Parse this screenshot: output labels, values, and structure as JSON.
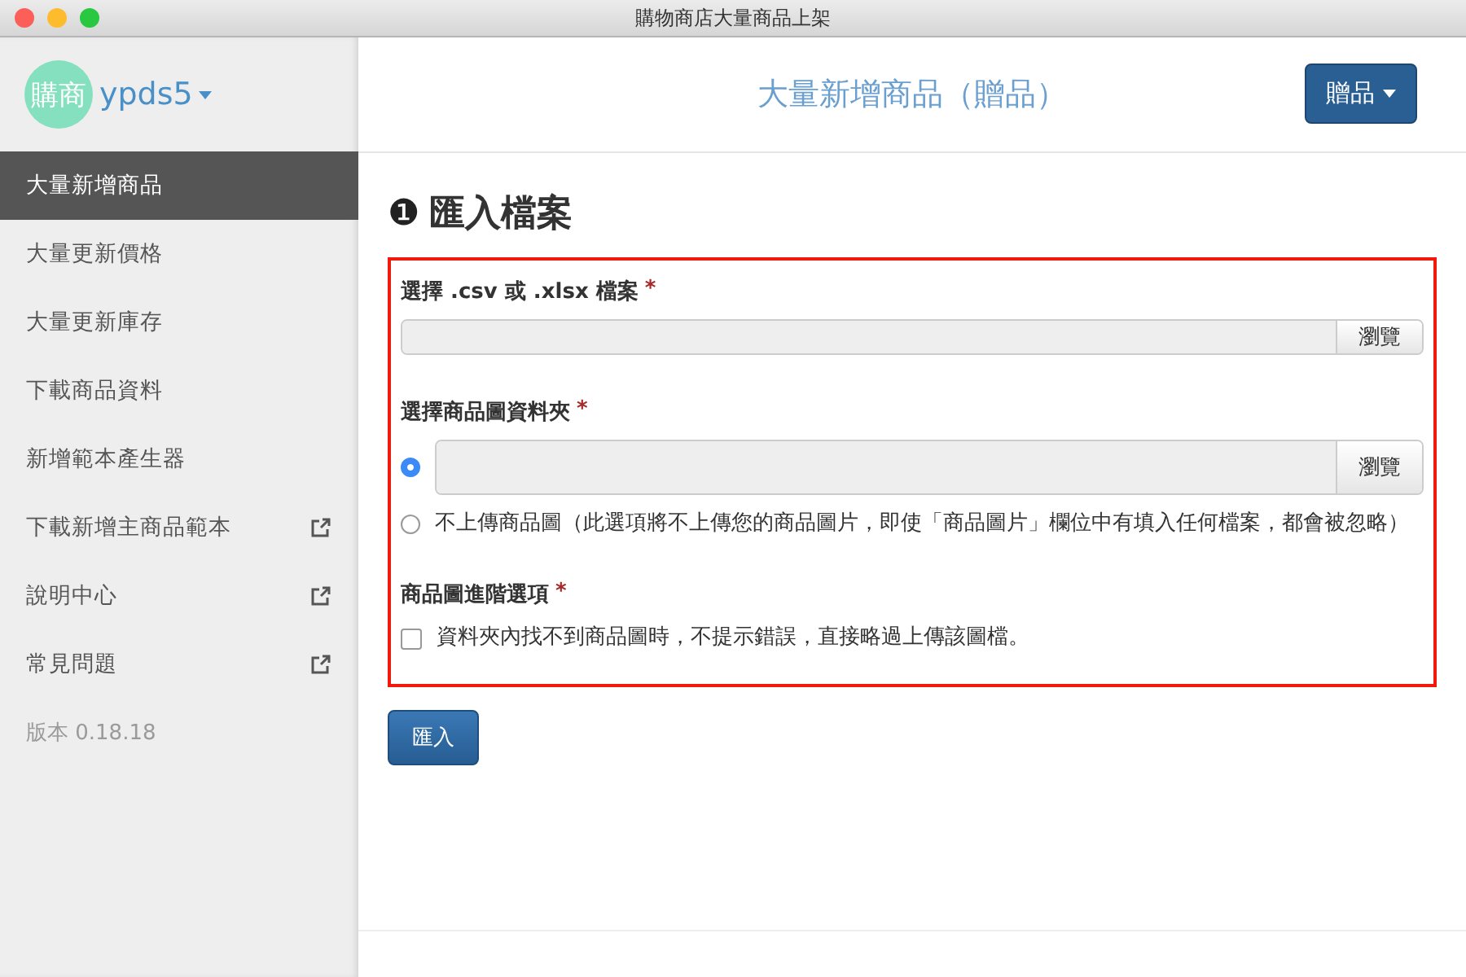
{
  "window": {
    "title": "購物商店大量商品上架"
  },
  "sidebar": {
    "avatar": "購商",
    "user": "ypds5",
    "items": [
      {
        "label": "大量新增商品",
        "selected": true,
        "external": false
      },
      {
        "label": "大量更新價格",
        "selected": false,
        "external": false
      },
      {
        "label": "大量更新庫存",
        "selected": false,
        "external": false
      },
      {
        "label": "下載商品資料",
        "selected": false,
        "external": false
      },
      {
        "label": "新增範本產生器",
        "selected": false,
        "external": false
      },
      {
        "label": "下載新增主商品範本",
        "selected": false,
        "external": true
      },
      {
        "label": "說明中心",
        "selected": false,
        "external": true
      },
      {
        "label": "常見問題",
        "selected": false,
        "external": true
      }
    ],
    "version": "版本 0.18.18"
  },
  "header": {
    "title": "大量新增商品（贈品）",
    "menu_button": "贈品"
  },
  "section": {
    "step": "❶",
    "title": "匯入檔案",
    "file_field": {
      "label": "選擇 .csv 或 .xlsx 檔案",
      "required": "*",
      "browse": "瀏覽"
    },
    "folder_field": {
      "label": "選擇商品圖資料夾",
      "required": "*",
      "options": [
        {
          "kind": "file",
          "selected": true,
          "browse": "瀏覽"
        },
        {
          "kind": "text",
          "selected": false,
          "label": "不上傳商品圖（此選項將不上傳您的商品圖片，即使「商品圖片」欄位中有填入任何檔案，都會被忽略）"
        }
      ]
    },
    "advanced": {
      "label": "商品圖進階選項",
      "required": "*",
      "option": {
        "label": "資料夾內找不到商品圖時，不提示錯誤，直接略過上傳該圖檔。",
        "checked": false
      }
    },
    "submit": "匯入"
  }
}
